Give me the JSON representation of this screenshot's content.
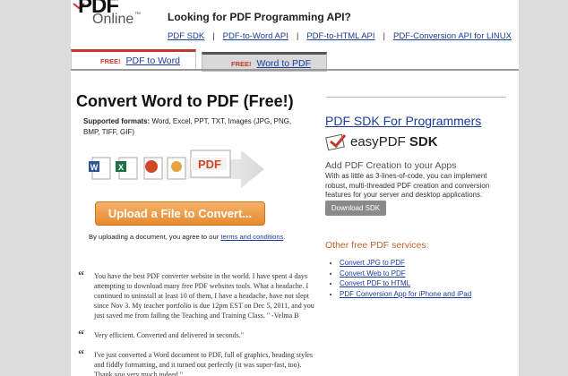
{
  "header": {
    "logo_pdf": "PDF",
    "logo_online": "Online",
    "logo_tm": "™",
    "api_title": "Looking for PDF Programming API?",
    "api_links": [
      "PDF SDK",
      "PDF-to-Word API",
      "PDF-to-HTML API",
      "PDF-Conversion API for LINUX"
    ],
    "separator": "|"
  },
  "tabs": [
    {
      "badge": "FREE!",
      "label": "PDF to Word",
      "active": true
    },
    {
      "badge": "FREE!",
      "label": "Word to PDF",
      "active": false
    }
  ],
  "main": {
    "title": "Convert Word to PDF (Free!)",
    "formats_label": "Supported formats:",
    "formats_value": "Word, Excel, PPT, TXT, Images (JPG, PNG, BMP, TIFF, GIF)",
    "icon_pdf_text": "PDF",
    "upload_button": "Upload a File to Convert...",
    "agree_prefix": "By uploading a document, you agree to our ",
    "agree_link": "terms and conditions",
    "agree_suffix": ".",
    "quote_mark": "“",
    "testimonials": [
      "You have the best PDF converter website in the world. I have spent 4 days attempting to download many free PDF websites tools. What a headache. I continued to uninstall at least 10 of them, I have a headache, have not slept since Nov 3. My teacher portfolio is due 12pm EST on Dec 5, 2011, and you just saved me from failing the Teaching and Training Class. \" -Velma B",
      "Very efficient. Converted and delivered in seconds.\"",
      "I've just converted a Word document to PDF, full of graphics, heading styles and fiddly formatting, and it turned out perfectly (it was super-fast, too). Thank you very much indeed.\""
    ]
  },
  "sidebar": {
    "sdk_title": "PDF SDK For Programmers",
    "sdk_logo_easy": "easy",
    "sdk_logo_pdf": "PDF",
    "sdk_logo_sdk": "SDK",
    "add_creation": "Add PDF Creation to your Apps",
    "sdk_desc": "With as little as 3-lines-of-code, you can implement robust, multi-threaded PDF creation and conversion features for your server and desktop applications.",
    "download_button": "Download SDK",
    "other_title": "Other free PDF services:",
    "other_links": [
      "Convert JPG to PDF",
      "Convert Web to PDF",
      "Convert PDF to HTML",
      "PDF Conversion App for iPhone and iPad"
    ]
  },
  "colors": {
    "accent_red": "#c0392b",
    "link_blue": "#1a3d9c",
    "upload_orange": "#e68a2e",
    "other_title_orange": "#c0612b"
  }
}
